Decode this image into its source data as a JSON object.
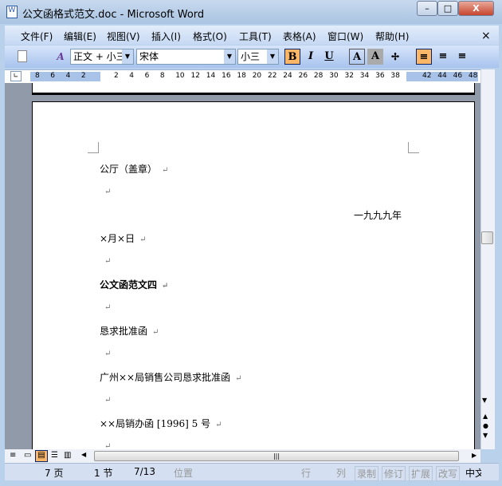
{
  "window": {
    "title": "公文函格式范文.doc - Microsoft Word",
    "minimize": "–",
    "maximize": "□",
    "close": "X"
  },
  "menu": [
    "文件(F)",
    "编辑(E)",
    "视图(V)",
    "插入(I)",
    "格式(O)",
    "工具(T)",
    "表格(A)",
    "窗口(W)",
    "帮助(H)"
  ],
  "menu_close": "×",
  "toolbar": {
    "style": "正文 + 小三",
    "font": "宋体",
    "size": "小三",
    "bold": "B",
    "italic": "I",
    "underline": "U",
    "border": "A",
    "shade": "A"
  },
  "ruler": {
    "left": [
      "8",
      "6",
      "4",
      "2"
    ],
    "main": [
      "2",
      "4",
      "6",
      "8",
      "10",
      "12",
      "14",
      "16",
      "18",
      "20",
      "22",
      "24",
      "26",
      "28",
      "30",
      "32",
      "34",
      "36",
      "38"
    ],
    "right": [
      "42",
      "44",
      "46",
      "48"
    ]
  },
  "document": {
    "lines": [
      {
        "text": "公厅（盖章）",
        "align": "left"
      },
      {
        "text": "",
        "align": "left"
      },
      {
        "text": "一九九九年",
        "align": "right"
      },
      {
        "text": "×月×日",
        "align": "left"
      },
      {
        "text": "",
        "align": "left"
      },
      {
        "text": "公文函范文四",
        "align": "left",
        "bold": true
      },
      {
        "text": "",
        "align": "left"
      },
      {
        "text": "恳求批准函",
        "align": "left"
      },
      {
        "text": "",
        "align": "left"
      },
      {
        "text": "广州××局销售公司恳求批准函",
        "align": "left"
      },
      {
        "text": "",
        "align": "left"
      },
      {
        "text": "××局销办函 [1996] 5 号",
        "align": "left"
      },
      {
        "text": "",
        "align": "left"
      }
    ],
    "para_mark": "↵"
  },
  "status": {
    "page": "7 页",
    "section": "1 节",
    "pages": "7/13",
    "position": "位置",
    "row": "行",
    "col": "列",
    "rec": "录制",
    "trk": "修订",
    "ext": "扩展",
    "ovr": "改写",
    "lang": "中文"
  }
}
